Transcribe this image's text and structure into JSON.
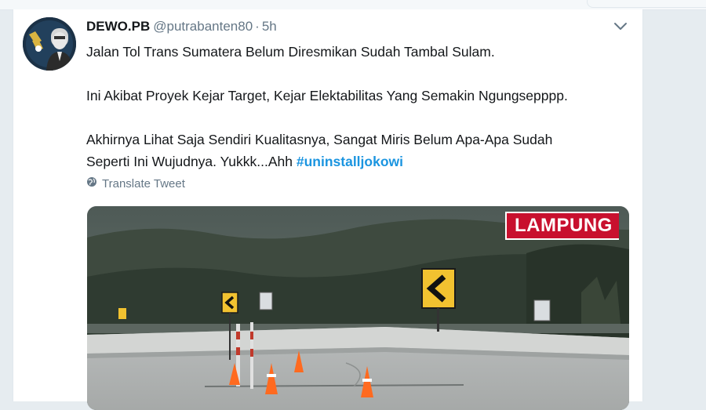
{
  "tweet": {
    "display_name": "DEWO.PB",
    "handle": "@putrabanten80",
    "separator": "·",
    "time": "5h",
    "lines": [
      "Jalan Tol Trans Sumatera Belum Diresmikan Sudah Tambal Sulam.",
      "Ini Akibat Proyek Kejar Target, Kejar Elektabilitas Yang Semakin Ngungsepppp.",
      "Akhirnya Lihat Saja Sendiri Kualitasnya, Sangat Miris Belum Apa-Apa Sudah",
      "Seperti Ini Wujudnya. Yukkk...Ahh"
    ],
    "hashtag": "#uninstalljokowi",
    "translate_label": "Translate Tweet"
  },
  "media": {
    "channel_tag": "LAMPUNG"
  },
  "colors": {
    "link": "#1b95e0",
    "secondary_text": "#657786",
    "channel_tag_bg": "#c8102e"
  },
  "icons": {
    "caret": "chevron-down-icon",
    "translate": "globe-icon"
  }
}
